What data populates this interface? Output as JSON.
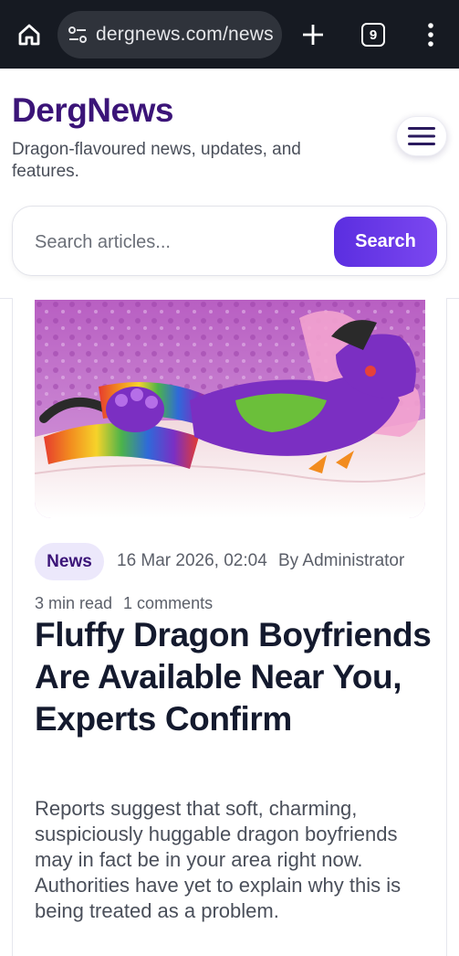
{
  "browser": {
    "url": "dergnews.com/news",
    "tab_count": "9"
  },
  "site": {
    "title": "DergNews",
    "tagline": "Dragon-flavoured news, updates, and features."
  },
  "search": {
    "placeholder": "Search articles...",
    "button_label": "Search"
  },
  "article": {
    "category": "News",
    "date": "16 Mar 2026, 02:04",
    "author": "By Administrator",
    "read_time": "3 min read",
    "comments": "1 comments",
    "headline": "Fluffy Dragon Boyfriends Are Available Near You, Experts Confirm",
    "excerpt": "Reports suggest that soft, charming, suspiciously huggable dragon boyfriends may in fact be in your area right now. Authorities have yet to explain why this is being treated as a problem."
  },
  "colors": {
    "brand": "#3b1478",
    "accent": "#6a3ae8",
    "chrome_bg": "#161a22"
  },
  "icons": [
    "home-icon",
    "site-settings-icon",
    "new-tab-icon",
    "tab-switcher-icon",
    "more-menu-icon",
    "hamburger-menu-icon"
  ]
}
